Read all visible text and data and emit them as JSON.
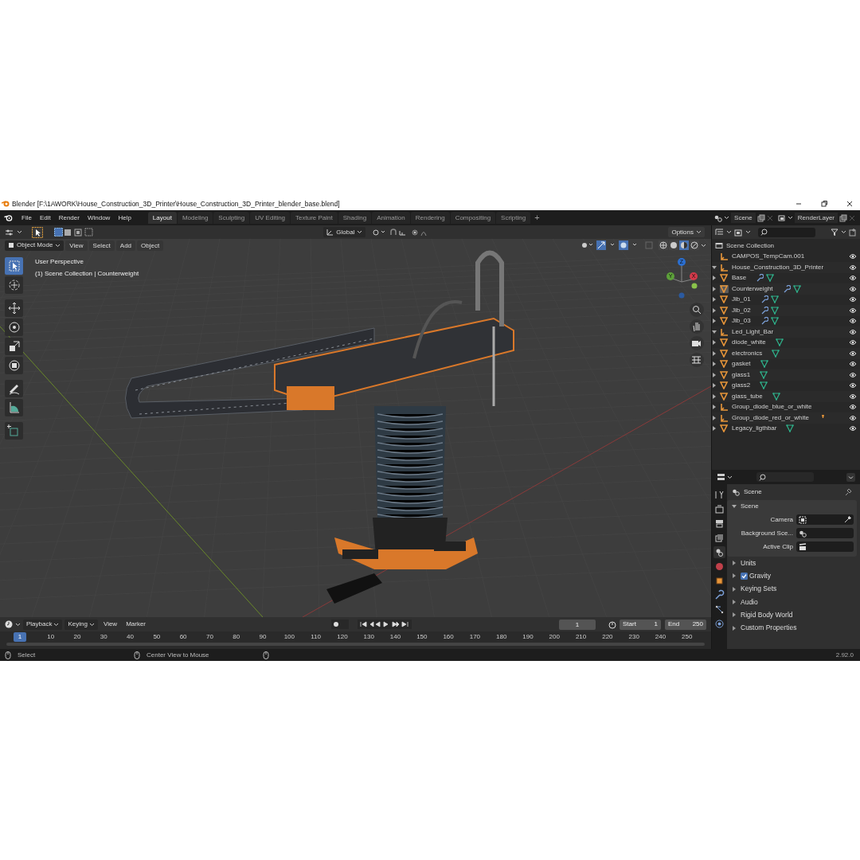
{
  "window": {
    "title": "Blender [F:\\1AWORK\\House_Construction_3D_Printer\\House_Construction_3D_Printer_blender_base.blend]"
  },
  "menu": [
    "File",
    "Edit",
    "Render",
    "Window",
    "Help"
  ],
  "workspaces": [
    {
      "label": "Layout",
      "selected": true
    },
    {
      "label": "Modeling",
      "selected": false
    },
    {
      "label": "Sculpting",
      "selected": false
    },
    {
      "label": "UV Editing",
      "selected": false
    },
    {
      "label": "Texture Paint",
      "selected": false
    },
    {
      "label": "Shading",
      "selected": false
    },
    {
      "label": "Animation",
      "selected": false
    },
    {
      "label": "Rendering",
      "selected": false
    },
    {
      "label": "Compositing",
      "selected": false
    },
    {
      "label": "Scripting",
      "selected": false
    }
  ],
  "add_workspace": "+",
  "scene": {
    "value": "Scene"
  },
  "view_layer": {
    "value": "RenderLayer"
  },
  "tool_header": {
    "orientation": "Global",
    "options": "Options"
  },
  "viewport_header": {
    "mode": "Object Mode",
    "menus": [
      "View",
      "Select",
      "Add",
      "Object"
    ]
  },
  "viewport": {
    "info": [
      "User Perspective",
      "(1) Scene Collection | Counterweight"
    ],
    "tools": [
      {
        "kind": "select",
        "selected": true
      },
      {
        "kind": "cursor",
        "selected": false
      },
      {
        "kind": "move",
        "selected": false
      },
      {
        "kind": "rotate",
        "selected": false
      },
      {
        "kind": "scale",
        "selected": false
      },
      {
        "kind": "transform",
        "selected": false
      },
      {
        "kind": "annotate",
        "selected": false
      },
      {
        "kind": "measure",
        "selected": false
      },
      {
        "kind": "add",
        "selected": false
      }
    ],
    "shading": [
      {
        "kind": "wireframe",
        "selected": false
      },
      {
        "kind": "solid",
        "selected": false
      },
      {
        "kind": "material",
        "selected": true
      },
      {
        "kind": "rendered",
        "selected": false
      }
    ],
    "gizmo_axes": [
      "Z",
      "Y",
      "X"
    ]
  },
  "outliner": {
    "root": "Scene Collection",
    "items": [
      {
        "name": "CAMPOS_TempCam.001",
        "kind": "empty"
      },
      {
        "name": "House_Construction_3D_Printer",
        "kind": "empty",
        "expanded": true,
        "children": [
          {
            "name": "Base",
            "kind": "mesh",
            "expanded": false,
            "active": false,
            "modifier": true,
            "mesh_data": true,
            "light_data": false
          },
          {
            "name": "Counterweight",
            "kind": "mesh",
            "expanded": false,
            "active": true,
            "modifier": true,
            "mesh_data": true,
            "light_data": false
          },
          {
            "name": "Jib_01",
            "kind": "mesh",
            "expanded": false,
            "active": false,
            "modifier": true,
            "mesh_data": true,
            "light_data": false
          },
          {
            "name": "Jib_02",
            "kind": "mesh",
            "expanded": false,
            "active": false,
            "modifier": true,
            "mesh_data": true,
            "light_data": false
          },
          {
            "name": "Jib_03",
            "kind": "mesh",
            "expanded": false,
            "active": false,
            "modifier": true,
            "mesh_data": true,
            "light_data": false
          }
        ]
      },
      {
        "name": "Led_Light_Bar",
        "kind": "empty",
        "expanded": true,
        "children": [
          {
            "name": "diode_white",
            "kind": "mesh",
            "expanded": false,
            "active": false,
            "modifier": false,
            "mesh_data": true,
            "light_data": false
          },
          {
            "name": "electronics",
            "kind": "mesh",
            "expanded": false,
            "active": false,
            "modifier": false,
            "mesh_data": true,
            "light_data": false
          },
          {
            "name": "gasket",
            "kind": "mesh",
            "expanded": false,
            "active": false,
            "modifier": false,
            "mesh_data": true,
            "light_data": false
          },
          {
            "name": "glass1",
            "kind": "mesh",
            "expanded": false,
            "active": false,
            "modifier": false,
            "mesh_data": true,
            "light_data": false
          },
          {
            "name": "glass2",
            "kind": "mesh",
            "expanded": false,
            "active": false,
            "modifier": false,
            "mesh_data": true,
            "light_data": false
          },
          {
            "name": "glass_tube",
            "kind": "mesh",
            "expanded": false,
            "active": false,
            "modifier": false,
            "mesh_data": true,
            "light_data": false
          },
          {
            "name": "Group_diode_blue_or_white",
            "kind": "empty",
            "expanded": false,
            "active": false,
            "modifier": false,
            "mesh_data": false,
            "light_data": false
          },
          {
            "name": "Group_diode_red_or_white",
            "kind": "empty",
            "expanded": false,
            "active": false,
            "modifier": false,
            "mesh_data": false,
            "light_data": true
          },
          {
            "name": "Legacy_ligthbar",
            "kind": "mesh",
            "expanded": false,
            "active": false,
            "modifier": false,
            "mesh_data": true,
            "light_data": false
          }
        ]
      }
    ]
  },
  "properties": {
    "tabs": [
      {
        "kind": "tool",
        "selected": false
      },
      {
        "kind": "render",
        "selected": false
      },
      {
        "kind": "output",
        "selected": false
      },
      {
        "kind": "view_layer",
        "selected": false
      },
      {
        "kind": "scene",
        "selected": true
      },
      {
        "kind": "world",
        "selected": false
      },
      {
        "kind": "object",
        "selected": false
      },
      {
        "kind": "modifiers",
        "selected": false
      },
      {
        "kind": "particles",
        "selected": false
      },
      {
        "kind": "physics",
        "selected": false
      }
    ],
    "context": "Scene",
    "panel": {
      "title": "Scene",
      "expanded": true,
      "fields": [
        {
          "label": "Camera"
        },
        {
          "label": "Background Sce..."
        },
        {
          "label": "Active Clip"
        }
      ]
    },
    "subpanels": [
      {
        "label": "Units"
      },
      {
        "label": "Gravity",
        "checked": true
      },
      {
        "label": "Keying Sets"
      },
      {
        "label": "Audio"
      },
      {
        "label": "Rigid Body World"
      },
      {
        "label": "Custom Properties"
      }
    ]
  },
  "timeline": {
    "menus": [
      "Playback",
      "Keying",
      "View",
      "Marker"
    ],
    "current_frame": "1",
    "start_label": "Start",
    "start": "1",
    "end_label": "End",
    "end": "250",
    "ruler": [
      {
        "label": "1",
        "selected": true
      },
      {
        "label": "10",
        "selected": false
      },
      {
        "label": "20",
        "selected": false
      },
      {
        "label": "30",
        "selected": false
      },
      {
        "label": "40",
        "selected": false
      },
      {
        "label": "50",
        "selected": false
      },
      {
        "label": "60",
        "selected": false
      },
      {
        "label": "70",
        "selected": false
      },
      {
        "label": "80",
        "selected": false
      },
      {
        "label": "90",
        "selected": false
      },
      {
        "label": "100",
        "selected": false
      },
      {
        "label": "110",
        "selected": false
      },
      {
        "label": "120",
        "selected": false
      },
      {
        "label": "130",
        "selected": false
      },
      {
        "label": "140",
        "selected": false
      },
      {
        "label": "150",
        "selected": false
      },
      {
        "label": "160",
        "selected": false
      },
      {
        "label": "170",
        "selected": false
      },
      {
        "label": "180",
        "selected": false
      },
      {
        "label": "190",
        "selected": false
      },
      {
        "label": "200",
        "selected": false
      },
      {
        "label": "210",
        "selected": false
      },
      {
        "label": "220",
        "selected": false
      },
      {
        "label": "230",
        "selected": false
      },
      {
        "label": "240",
        "selected": false
      },
      {
        "label": "250",
        "selected": false
      }
    ]
  },
  "status_bar": {
    "hints": [
      "Select",
      "Center View to Mouse"
    ],
    "version": "2.92.0"
  }
}
